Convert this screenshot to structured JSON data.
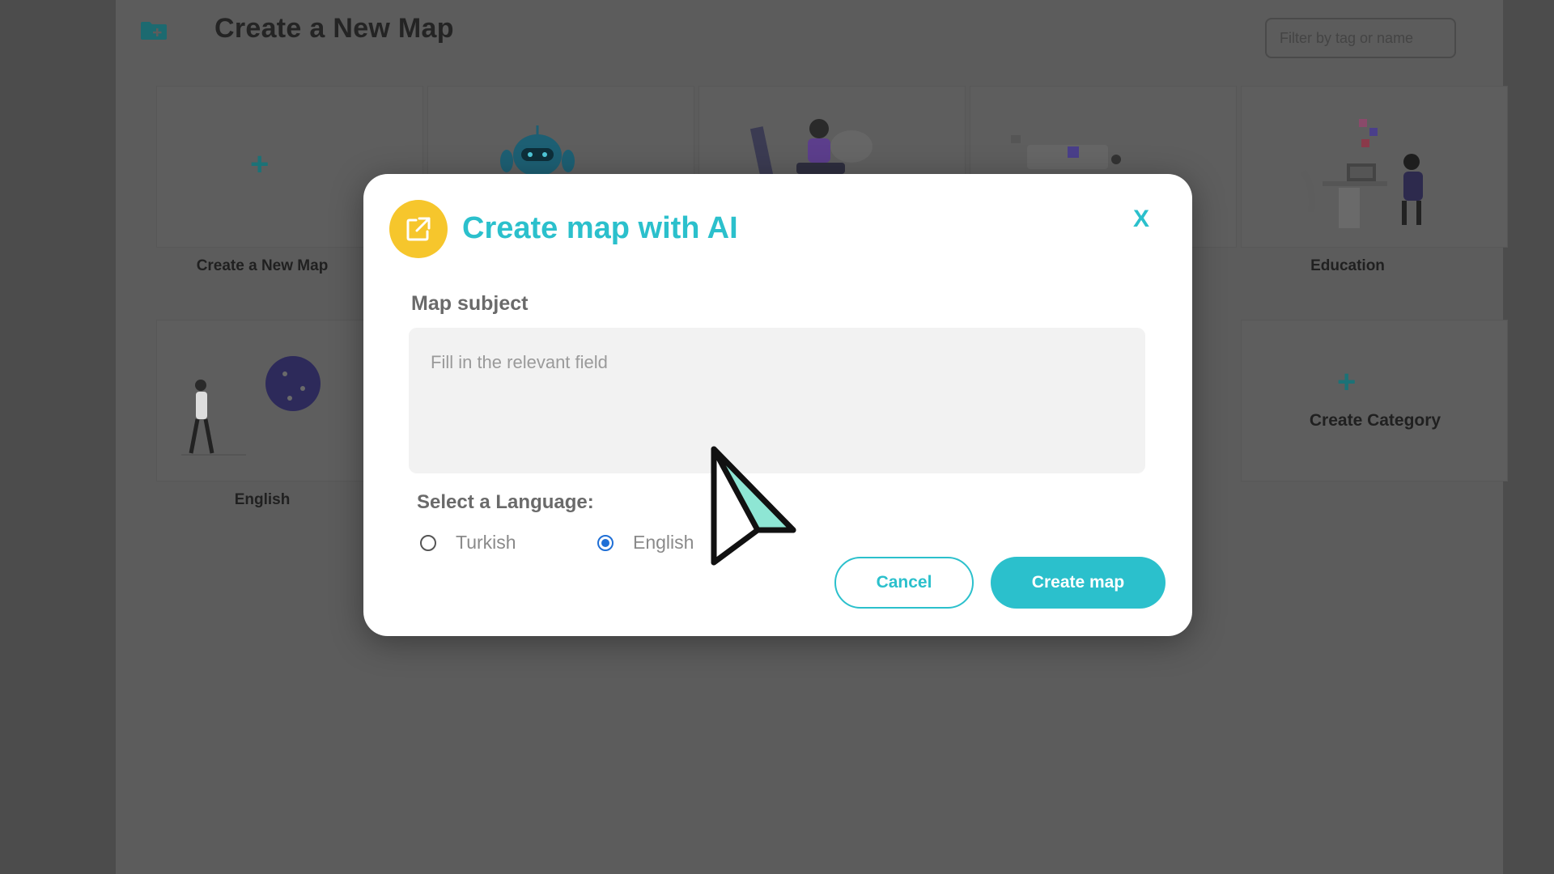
{
  "header": {
    "title": "Create a New Map",
    "filter_placeholder": "Filter by tag or name"
  },
  "cards": {
    "new_map_label": "Create a New Map",
    "education_label": "Education",
    "english_label": "English",
    "create_category_label": "Create Category",
    "plus_symbol": "+"
  },
  "modal": {
    "title": "Create map with AI",
    "close_label": "X",
    "subject_label": "Map subject",
    "subject_placeholder": "Fill in the relevant field",
    "subject_value": "",
    "language_label": "Select a Language:",
    "languages": [
      {
        "label": "Turkish",
        "selected": false
      },
      {
        "label": "English",
        "selected": true
      }
    ],
    "cancel_label": "Cancel",
    "create_label": "Create map"
  },
  "colors": {
    "accent": "#2bc0cc",
    "icon_bg": "#f6c62c",
    "radio_selected": "#1f6fd6"
  },
  "icons": {
    "folder": "folder-plus-icon",
    "modal": "external-link-icon",
    "cursor": "mouse-cursor-icon"
  }
}
